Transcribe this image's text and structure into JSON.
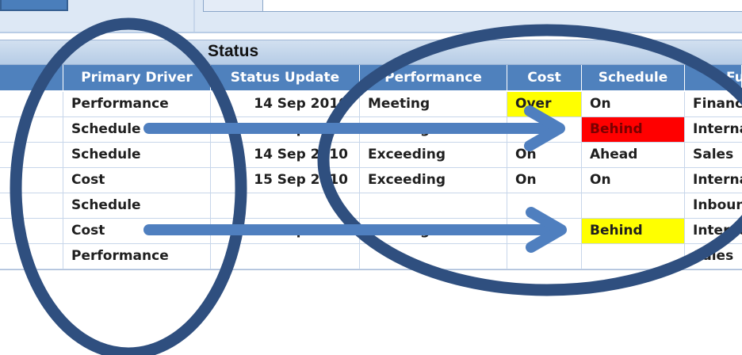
{
  "table": {
    "group_title": "Status",
    "columns": [
      "",
      "Primary Driver",
      "Status Update",
      "Performance",
      "Cost",
      "Schedule",
      "Fu"
    ],
    "rows": [
      {
        "driver": "Performance",
        "status_update": "14 Sep 2010",
        "performance": "Meeting",
        "cost": "Over",
        "schedule": "On",
        "function": "Finance"
      },
      {
        "driver": "Schedule",
        "status_update": "14 Sep 2010",
        "performance": "Meeting",
        "cost": "On",
        "schedule": "Behind",
        "function": "Internal"
      },
      {
        "driver": "Schedule",
        "status_update": "14 Sep 2010",
        "performance": "Exceeding",
        "cost": "On",
        "schedule": "Ahead",
        "function": "Sales"
      },
      {
        "driver": "Cost",
        "status_update": "15 Sep 2010",
        "performance": "Exceeding",
        "cost": "On",
        "schedule": "On",
        "function": "Internal"
      },
      {
        "driver": "Schedule",
        "status_update": "",
        "performance": "",
        "cost": "",
        "schedule": "",
        "function": "Inbound"
      },
      {
        "driver": "Cost",
        "status_update": "15 Sep 2010",
        "performance": "Meeting",
        "cost": "On",
        "schedule": "Behind",
        "function": "Internal"
      },
      {
        "driver": "Performance",
        "status_update": "",
        "performance": "",
        "cost": "",
        "schedule": "",
        "function": "Sales"
      }
    ]
  },
  "highlights": {
    "over": "#ffff00",
    "behind_red": "#ff0000",
    "behind_yellow": "#ffff00"
  },
  "annotation_colors": {
    "ellipse": "#2f4f7f",
    "arrow": "#4f7fbf"
  }
}
